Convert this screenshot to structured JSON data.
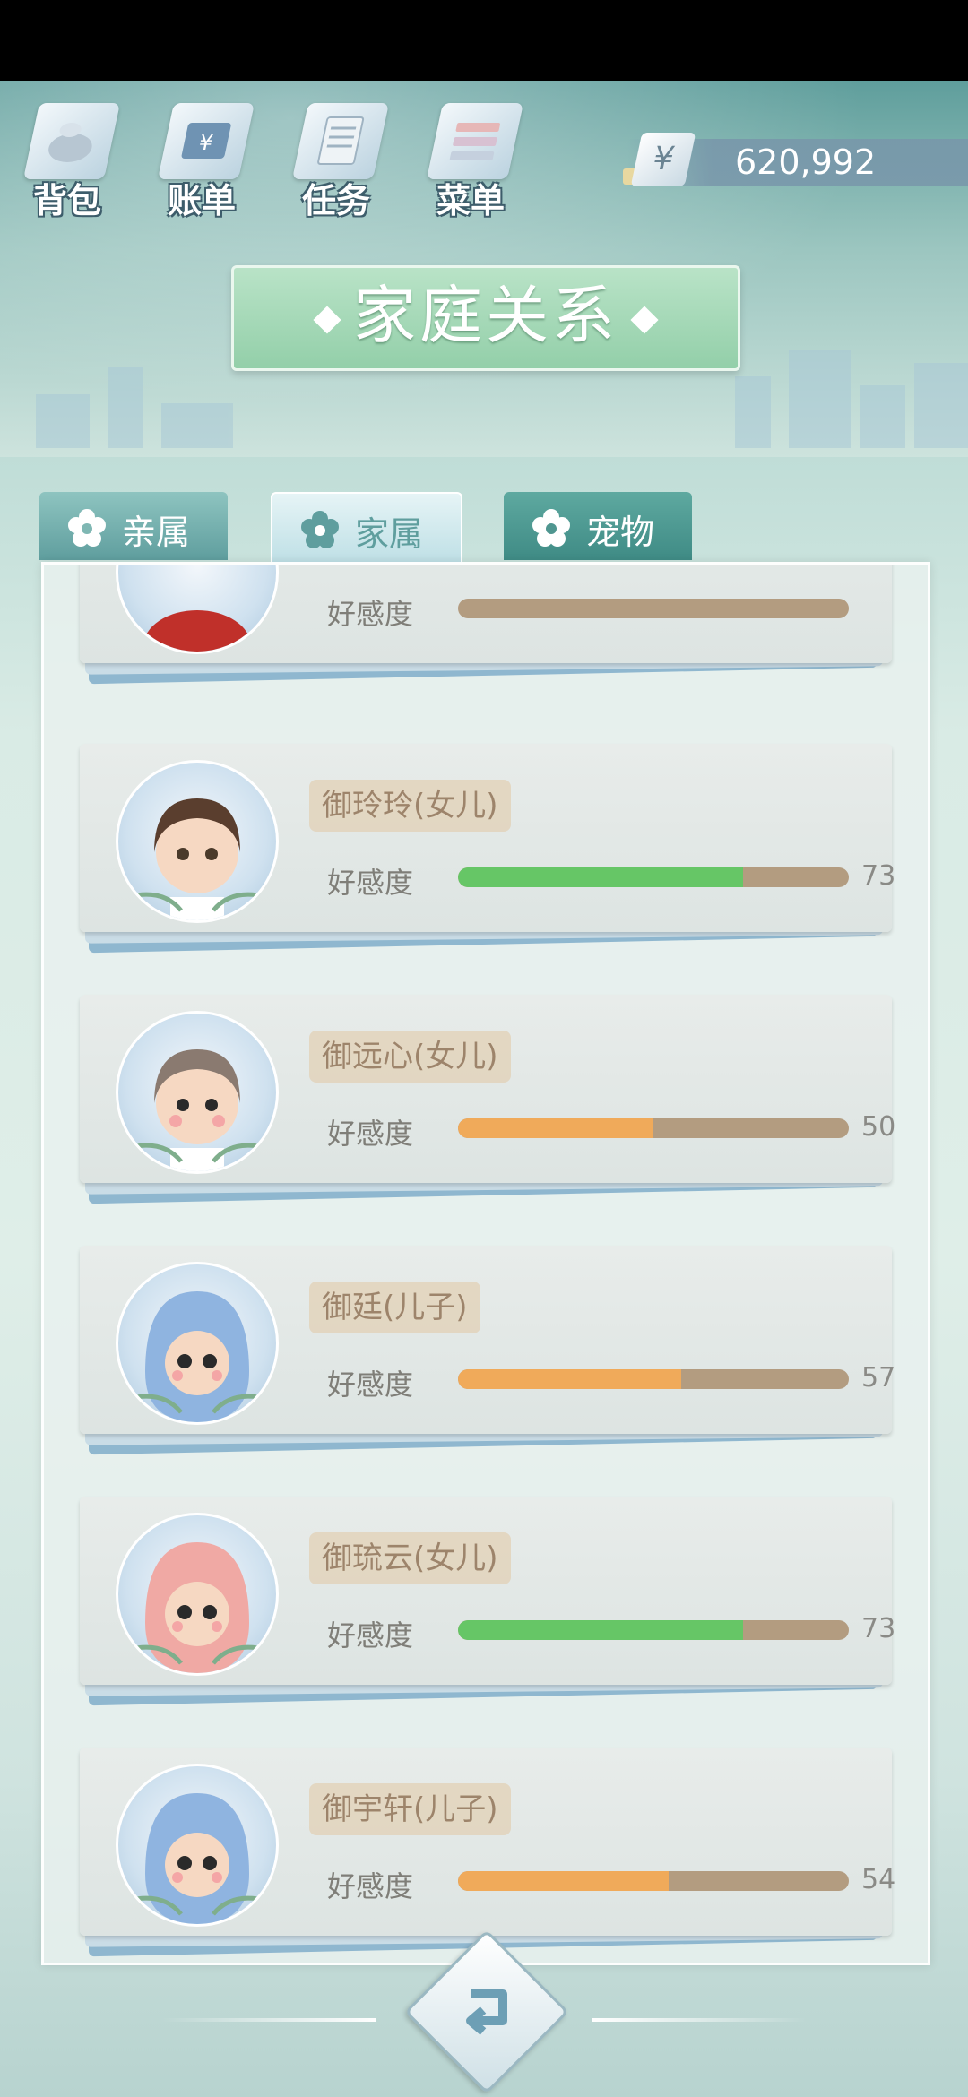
{
  "toolbar": {
    "items": [
      {
        "label": "背包",
        "icon": "bag-icon"
      },
      {
        "label": "账单",
        "icon": "bill-icon"
      },
      {
        "label": "任务",
        "icon": "task-icon"
      },
      {
        "label": "菜单",
        "icon": "menu-icon"
      }
    ]
  },
  "currency": {
    "symbol": "¥",
    "amount": "620,992"
  },
  "title": "家庭关系",
  "tabs": [
    {
      "label": "亲属",
      "active": false
    },
    {
      "label": "家属",
      "active": true
    },
    {
      "label": "宠物",
      "active": false
    }
  ],
  "favor_label": "好感度",
  "members": [
    {
      "name": "御玲玲(女儿)",
      "favor": 73,
      "favor_color": "#66c666",
      "avatar": "girl-dark-hair"
    },
    {
      "name": "御远心(女儿)",
      "favor": 50,
      "favor_color": "#f0aa5a",
      "avatar": "girl-gray-hair"
    },
    {
      "name": "御廷(儿子)",
      "favor": 57,
      "favor_color": "#f0aa5a",
      "avatar": "baby-blue-hood"
    },
    {
      "name": "御琉云(女儿)",
      "favor": 73,
      "favor_color": "#66c666",
      "avatar": "baby-pink-hood"
    },
    {
      "name": "御宇轩(儿子)",
      "favor": 54,
      "favor_color": "#f0aa5a",
      "avatar": "baby-blue-hood"
    }
  ],
  "partial_member": {
    "favor_label": "好感度"
  }
}
